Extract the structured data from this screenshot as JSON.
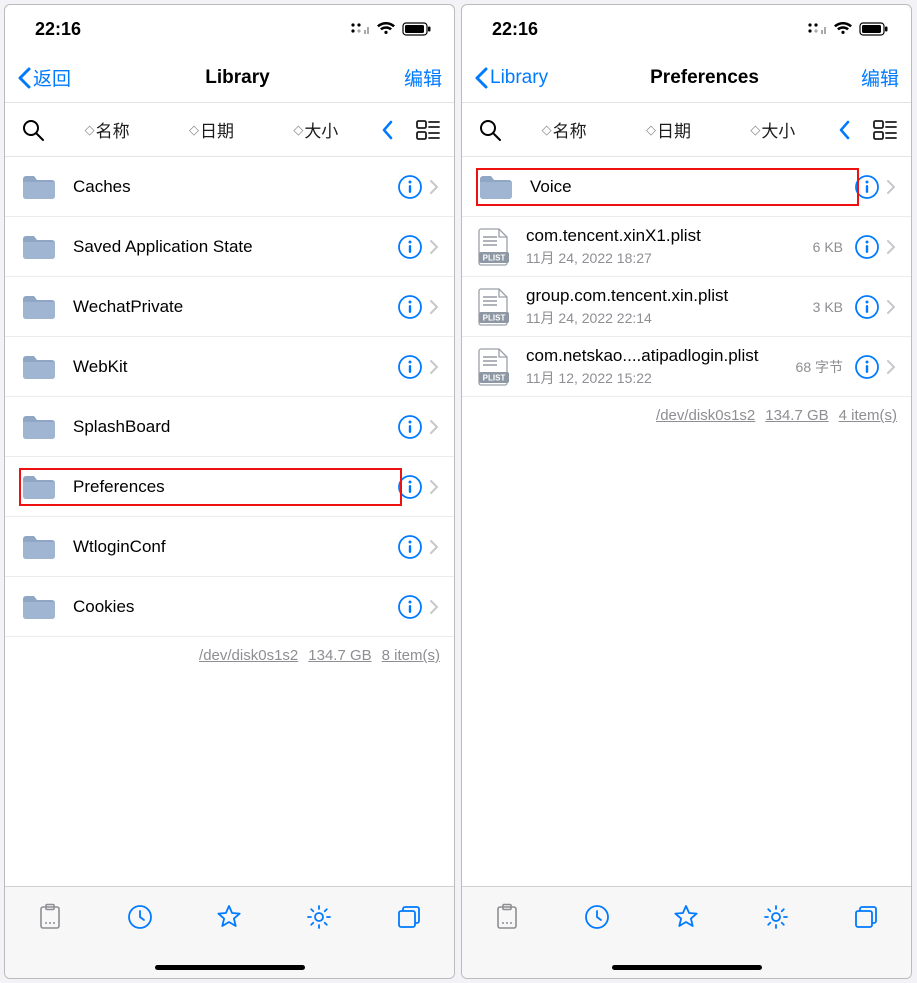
{
  "left": {
    "status_time": "22:16",
    "back_label": "返回",
    "title": "Library",
    "edit_label": "编辑",
    "sort": {
      "name": "名称",
      "date": "日期",
      "size": "大小"
    },
    "items": [
      {
        "name": "Caches",
        "type": "folder",
        "highlight": false
      },
      {
        "name": "Saved Application State",
        "type": "folder",
        "highlight": false
      },
      {
        "name": "WechatPrivate",
        "type": "folder",
        "highlight": false
      },
      {
        "name": "WebKit",
        "type": "folder",
        "highlight": false
      },
      {
        "name": "SplashBoard",
        "type": "folder",
        "highlight": false
      },
      {
        "name": "Preferences",
        "type": "folder",
        "highlight": true
      },
      {
        "name": "WtloginConf",
        "type": "folder",
        "highlight": false
      },
      {
        "name": "Cookies",
        "type": "folder",
        "highlight": false
      }
    ],
    "summary": {
      "disk": "/dev/disk0s1s2",
      "capacity": "134.7 GB",
      "count": "8 item(s)"
    }
  },
  "right": {
    "status_time": "22:16",
    "back_label": "Library",
    "title": "Preferences",
    "edit_label": "编辑",
    "sort": {
      "name": "名称",
      "date": "日期",
      "size": "大小"
    },
    "items": [
      {
        "name": "Voice",
        "type": "folder",
        "highlight": true
      },
      {
        "name": "com.tencent.xinX1.plist",
        "type": "plist",
        "sub": "11月 24, 2022 18:27",
        "size": "6 KB"
      },
      {
        "name": "group.com.tencent.xin.plist",
        "type": "plist",
        "sub": "11月 24, 2022 22:14",
        "size": "3 KB"
      },
      {
        "name": "com.netskao....atipadlogin.plist",
        "type": "plist",
        "sub": "11月 12, 2022 15:22",
        "size": "68 字节"
      }
    ],
    "summary": {
      "disk": "/dev/disk0s1s2",
      "capacity": "134.7 GB",
      "count": "4 item(s)"
    }
  }
}
